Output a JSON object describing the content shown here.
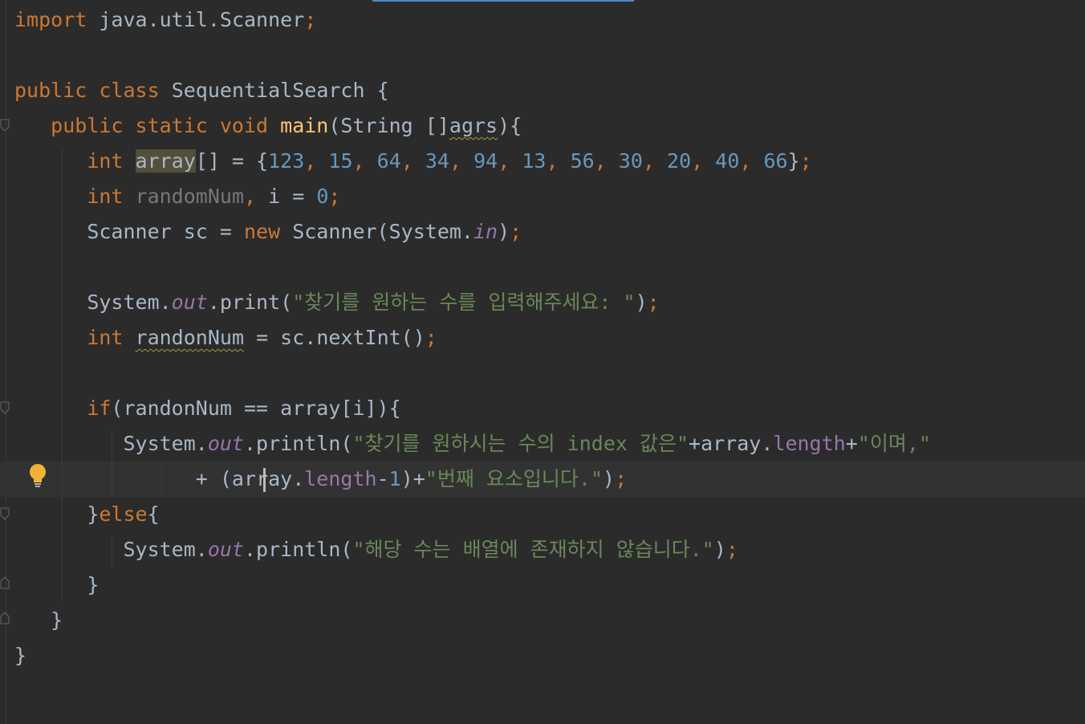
{
  "editor": {
    "file": "SequentialSearch.java",
    "lines": [
      {
        "tokens": [
          [
            "kw",
            "import"
          ],
          [
            "",
            "java.util.Scanner"
          ],
          [
            "kw",
            ";"
          ]
        ]
      },
      {
        "tokens": []
      },
      {
        "tokens": [
          [
            "kw",
            "public"
          ],
          [
            "",
            ""
          ],
          [
            "kw",
            "class"
          ],
          [
            "",
            "SequentialSearch {"
          ]
        ]
      },
      {
        "tokens": [
          [
            "kw",
            "public static void"
          ],
          [
            "fn",
            "main"
          ],
          [
            "",
            "(String []"
          ],
          [
            "squig",
            "agrs"
          ],
          [
            "",
            "){"
          ]
        ]
      },
      {
        "tokens": [
          [
            "kw",
            "int"
          ],
          [
            "hl",
            "array"
          ],
          [
            "",
            "[] = {"
          ],
          [
            "num",
            "123"
          ],
          [
            "kw",
            ","
          ],
          [
            "num",
            "15"
          ],
          [
            "kw",
            ","
          ],
          [
            "num",
            "64"
          ],
          [
            "kw",
            ","
          ],
          [
            "num",
            "34"
          ],
          [
            "kw",
            ","
          ],
          [
            "num",
            "94"
          ],
          [
            "kw",
            ","
          ],
          [
            "num",
            "13"
          ],
          [
            "kw",
            ","
          ],
          [
            "num",
            "56"
          ],
          [
            "kw",
            ","
          ],
          [
            "num",
            "30"
          ],
          [
            "kw",
            ","
          ],
          [
            "num",
            "20"
          ],
          [
            "kw",
            ","
          ],
          [
            "num",
            "40"
          ],
          [
            "kw",
            ","
          ],
          [
            "num",
            "66"
          ],
          [
            "",
            "}"
          ],
          [
            "kw",
            ";"
          ]
        ]
      },
      {
        "tokens": [
          [
            "kw",
            "int"
          ],
          [
            "unused",
            "randomNum"
          ],
          [
            "kw",
            ","
          ],
          [
            "",
            "i = "
          ],
          [
            "num",
            "0"
          ],
          [
            "kw",
            ";"
          ]
        ]
      },
      {
        "tokens": [
          [
            "",
            "Scanner sc = "
          ],
          [
            "kw",
            "new"
          ],
          [
            "",
            "Scanner(System."
          ],
          [
            "static",
            "in"
          ],
          [
            "",
            ")"
          ],
          [
            "kw",
            ";"
          ]
        ]
      },
      {
        "tokens": []
      },
      {
        "tokens": [
          [
            "",
            "System."
          ],
          [
            "static",
            "out"
          ],
          [
            "",
            ".print("
          ],
          [
            "str",
            "\"찾기를 원하는 수를 입력해주세요: \""
          ],
          [
            "",
            ")"
          ],
          [
            "kw",
            ";"
          ]
        ]
      },
      {
        "tokens": [
          [
            "kw",
            "int"
          ],
          [
            "squig",
            "randonNum"
          ],
          [
            "",
            ""
          ],
          [
            "",
            "= sc.nextInt()"
          ],
          [
            "kw",
            ";"
          ]
        ]
      },
      {
        "tokens": []
      },
      {
        "tokens": [
          [
            "kw",
            "if"
          ],
          [
            "",
            "(randonNum == array[i]){"
          ]
        ]
      },
      {
        "tokens": [
          [
            "",
            "System."
          ],
          [
            "static",
            "out"
          ],
          [
            "",
            ".println("
          ],
          [
            "str",
            "\"찾기를 원하시는 수의 index 값은\""
          ],
          [
            "",
            "+array."
          ],
          [
            "field",
            "length"
          ],
          [
            "",
            "+"
          ],
          [
            "str",
            "\"이며,\""
          ]
        ]
      },
      {
        "tokens": [
          [
            "",
            "+ (array."
          ],
          [
            "field",
            "length"
          ],
          [
            "",
            "-"
          ],
          [
            "num",
            "1"
          ],
          [
            "",
            "})+"
          ],
          [
            "str",
            "\"번째 요소입니다.\""
          ],
          [
            "",
            ")"
          ],
          [
            "kw",
            ";"
          ]
        ]
      },
      {
        "tokens": [
          [
            "",
            "}"
          ],
          [
            "kw",
            "else"
          ],
          [
            "",
            "{"
          ]
        ]
      },
      {
        "tokens": [
          [
            "",
            "System."
          ],
          [
            "static",
            "out"
          ],
          [
            "",
            ".println("
          ],
          [
            "str",
            "\"해당 수는 배열에 존재하지 않습니다.\""
          ],
          [
            "",
            ")"
          ],
          [
            "kw",
            ";"
          ]
        ]
      },
      {
        "tokens": [
          [
            "",
            "}"
          ]
        ]
      },
      {
        "tokens": [
          [
            "",
            "}"
          ]
        ]
      },
      {
        "tokens": [
          [
            "",
            "}"
          ]
        ]
      }
    ]
  },
  "colors": {
    "background": "#2b2b2b",
    "keyword": "#cc7832",
    "string": "#6a8759",
    "number": "#6897bb",
    "field": "#9876aa",
    "method": "#ffc66d",
    "text": "#a9b7c6"
  },
  "icons": {
    "intention": "lightbulb-icon",
    "fold": "fold-marker-icon"
  }
}
